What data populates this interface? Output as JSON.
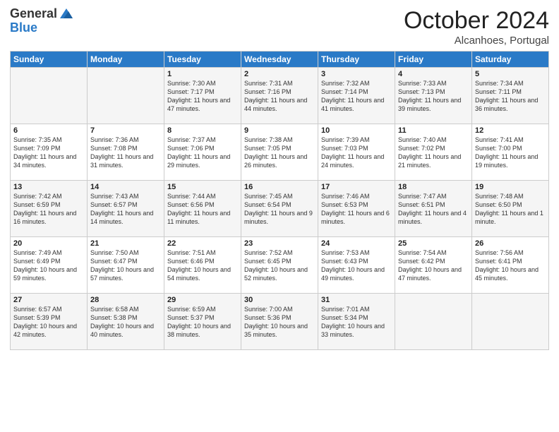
{
  "header": {
    "logo_general": "General",
    "logo_blue": "Blue",
    "month_title": "October 2024",
    "location": "Alcanhoes, Portugal"
  },
  "weekdays": [
    "Sunday",
    "Monday",
    "Tuesday",
    "Wednesday",
    "Thursday",
    "Friday",
    "Saturday"
  ],
  "weeks": [
    [
      null,
      null,
      {
        "day": 1,
        "sunrise": "7:30 AM",
        "sunset": "7:17 PM",
        "daylight": "11 hours and 47 minutes."
      },
      {
        "day": 2,
        "sunrise": "7:31 AM",
        "sunset": "7:16 PM",
        "daylight": "11 hours and 44 minutes."
      },
      {
        "day": 3,
        "sunrise": "7:32 AM",
        "sunset": "7:14 PM",
        "daylight": "11 hours and 41 minutes."
      },
      {
        "day": 4,
        "sunrise": "7:33 AM",
        "sunset": "7:13 PM",
        "daylight": "11 hours and 39 minutes."
      },
      {
        "day": 5,
        "sunrise": "7:34 AM",
        "sunset": "7:11 PM",
        "daylight": "11 hours and 36 minutes."
      }
    ],
    [
      {
        "day": 6,
        "sunrise": "7:35 AM",
        "sunset": "7:09 PM",
        "daylight": "11 hours and 34 minutes."
      },
      {
        "day": 7,
        "sunrise": "7:36 AM",
        "sunset": "7:08 PM",
        "daylight": "11 hours and 31 minutes."
      },
      {
        "day": 8,
        "sunrise": "7:37 AM",
        "sunset": "7:06 PM",
        "daylight": "11 hours and 29 minutes."
      },
      {
        "day": 9,
        "sunrise": "7:38 AM",
        "sunset": "7:05 PM",
        "daylight": "11 hours and 26 minutes."
      },
      {
        "day": 10,
        "sunrise": "7:39 AM",
        "sunset": "7:03 PM",
        "daylight": "11 hours and 24 minutes."
      },
      {
        "day": 11,
        "sunrise": "7:40 AM",
        "sunset": "7:02 PM",
        "daylight": "11 hours and 21 minutes."
      },
      {
        "day": 12,
        "sunrise": "7:41 AM",
        "sunset": "7:00 PM",
        "daylight": "11 hours and 19 minutes."
      }
    ],
    [
      {
        "day": 13,
        "sunrise": "7:42 AM",
        "sunset": "6:59 PM",
        "daylight": "11 hours and 16 minutes."
      },
      {
        "day": 14,
        "sunrise": "7:43 AM",
        "sunset": "6:57 PM",
        "daylight": "11 hours and 14 minutes."
      },
      {
        "day": 15,
        "sunrise": "7:44 AM",
        "sunset": "6:56 PM",
        "daylight": "11 hours and 11 minutes."
      },
      {
        "day": 16,
        "sunrise": "7:45 AM",
        "sunset": "6:54 PM",
        "daylight": "11 hours and 9 minutes."
      },
      {
        "day": 17,
        "sunrise": "7:46 AM",
        "sunset": "6:53 PM",
        "daylight": "11 hours and 6 minutes."
      },
      {
        "day": 18,
        "sunrise": "7:47 AM",
        "sunset": "6:51 PM",
        "daylight": "11 hours and 4 minutes."
      },
      {
        "day": 19,
        "sunrise": "7:48 AM",
        "sunset": "6:50 PM",
        "daylight": "11 hours and 1 minute."
      }
    ],
    [
      {
        "day": 20,
        "sunrise": "7:49 AM",
        "sunset": "6:49 PM",
        "daylight": "10 hours and 59 minutes."
      },
      {
        "day": 21,
        "sunrise": "7:50 AM",
        "sunset": "6:47 PM",
        "daylight": "10 hours and 57 minutes."
      },
      {
        "day": 22,
        "sunrise": "7:51 AM",
        "sunset": "6:46 PM",
        "daylight": "10 hours and 54 minutes."
      },
      {
        "day": 23,
        "sunrise": "7:52 AM",
        "sunset": "6:45 PM",
        "daylight": "10 hours and 52 minutes."
      },
      {
        "day": 24,
        "sunrise": "7:53 AM",
        "sunset": "6:43 PM",
        "daylight": "10 hours and 49 minutes."
      },
      {
        "day": 25,
        "sunrise": "7:54 AM",
        "sunset": "6:42 PM",
        "daylight": "10 hours and 47 minutes."
      },
      {
        "day": 26,
        "sunrise": "7:56 AM",
        "sunset": "6:41 PM",
        "daylight": "10 hours and 45 minutes."
      }
    ],
    [
      {
        "day": 27,
        "sunrise": "6:57 AM",
        "sunset": "5:39 PM",
        "daylight": "10 hours and 42 minutes."
      },
      {
        "day": 28,
        "sunrise": "6:58 AM",
        "sunset": "5:38 PM",
        "daylight": "10 hours and 40 minutes."
      },
      {
        "day": 29,
        "sunrise": "6:59 AM",
        "sunset": "5:37 PM",
        "daylight": "10 hours and 38 minutes."
      },
      {
        "day": 30,
        "sunrise": "7:00 AM",
        "sunset": "5:36 PM",
        "daylight": "10 hours and 35 minutes."
      },
      {
        "day": 31,
        "sunrise": "7:01 AM",
        "sunset": "5:34 PM",
        "daylight": "10 hours and 33 minutes."
      },
      null,
      null
    ]
  ]
}
